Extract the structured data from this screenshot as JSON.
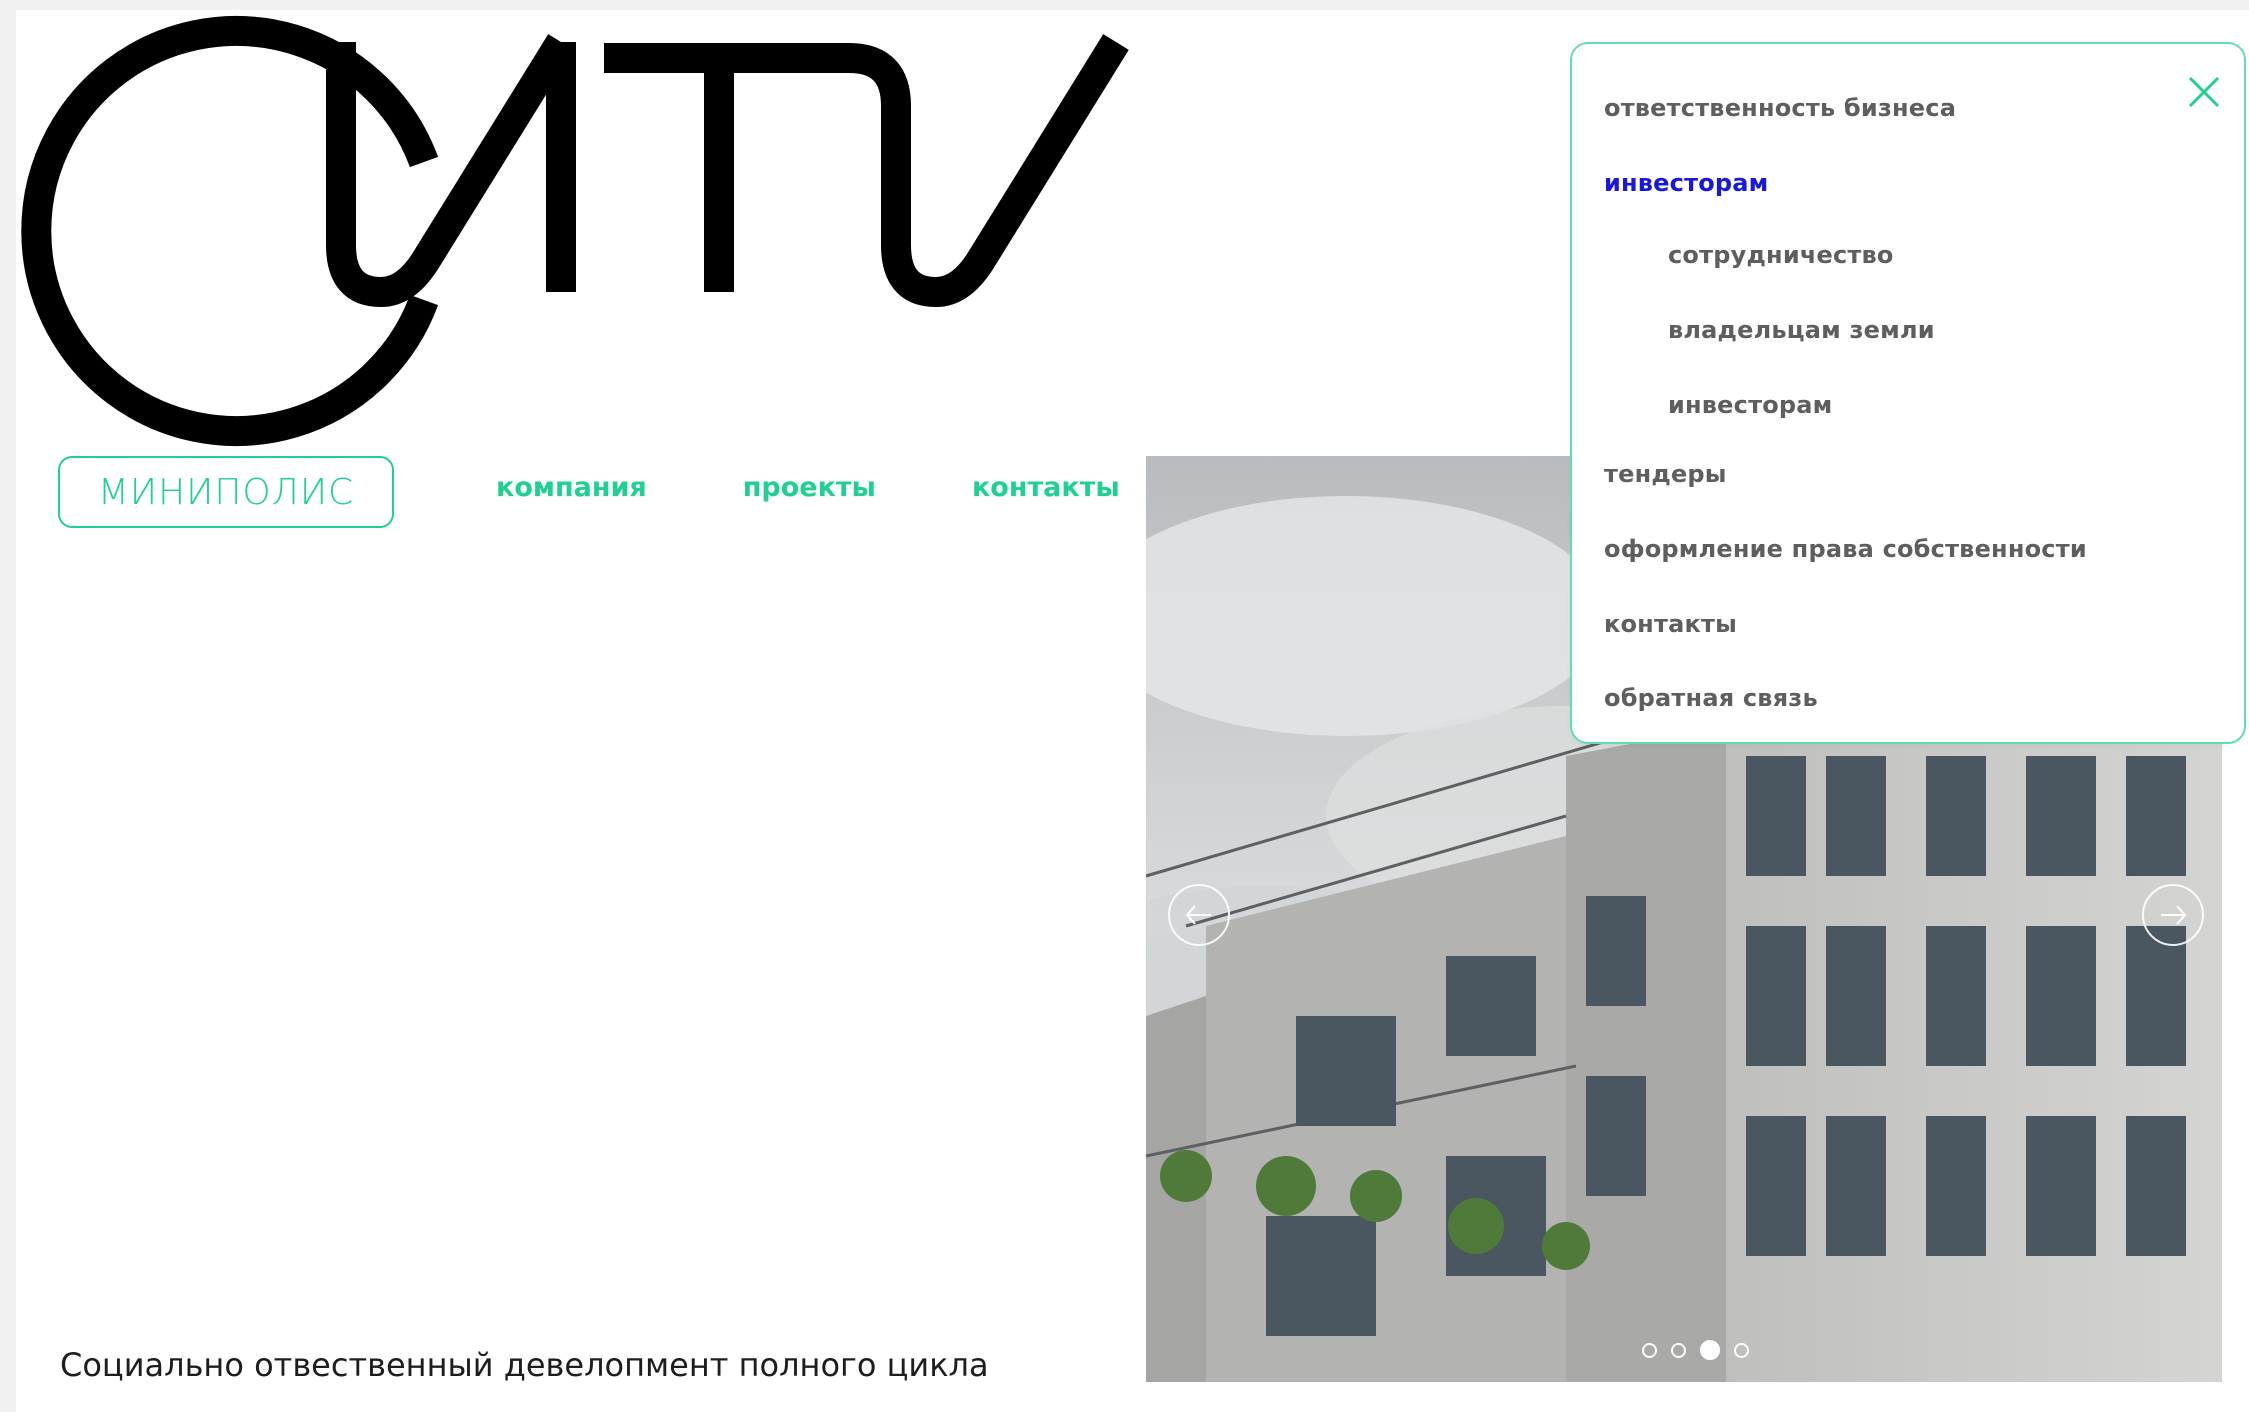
{
  "hero": {
    "logo_text": "СИТИ"
  },
  "header": {
    "brand_badge": "МИНИПОЛИС",
    "nav": [
      {
        "label": "компания"
      },
      {
        "label": "проекты"
      },
      {
        "label": "контакты"
      }
    ]
  },
  "tagline": "Социально отвественный девелопмент полного цикла",
  "slider": {
    "dots_total": 4,
    "active_dot": 3
  },
  "dropdown_menu": {
    "items": [
      {
        "label": "ответственность бизнеса"
      },
      {
        "label": "инвесторам"
      },
      {
        "label": "сотрудничество"
      },
      {
        "label": "владельцам земли"
      },
      {
        "label": "инвесторам"
      },
      {
        "label": "тендеры"
      },
      {
        "label": "оформление права собственности"
      },
      {
        "label": "контакты"
      },
      {
        "label": "обратная связь"
      }
    ]
  },
  "colors": {
    "accent_green": "#1fd18f",
    "active_link": "#1717e0",
    "menu_text": "#5e5e5e",
    "logo_black": "#000000"
  },
  "icons": {
    "close": "close-icon",
    "prev": "arrow-left-icon",
    "next": "arrow-right-icon"
  }
}
